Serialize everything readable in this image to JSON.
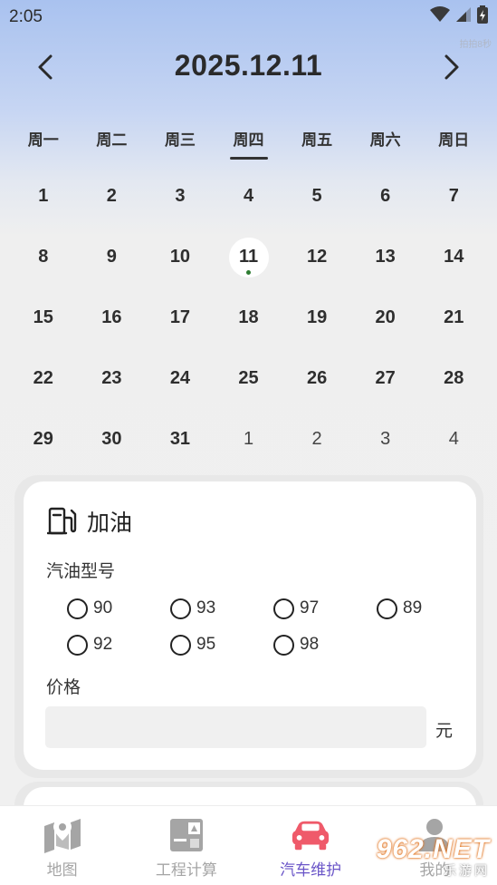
{
  "status": {
    "time": "2:05",
    "tiny": "拍拍8秒"
  },
  "header": {
    "title": "2025.12.11"
  },
  "weekdays": [
    "周一",
    "周二",
    "周三",
    "周四",
    "周五",
    "周六",
    "周日"
  ],
  "calendar": {
    "rows": [
      [
        "1",
        "2",
        "3",
        "4",
        "5",
        "6",
        "7"
      ],
      [
        "8",
        "9",
        "10",
        "11",
        "12",
        "13",
        "14"
      ],
      [
        "15",
        "16",
        "17",
        "18",
        "19",
        "20",
        "21"
      ],
      [
        "22",
        "23",
        "24",
        "25",
        "26",
        "27",
        "28"
      ],
      [
        "29",
        "30",
        "31",
        "1",
        "2",
        "3",
        "4"
      ]
    ]
  },
  "card": {
    "title": "加油",
    "fuel_type_label": "汽油型号",
    "options_row1": [
      "90",
      "93",
      "97",
      "89"
    ],
    "options_row2": [
      "92",
      "95",
      "98"
    ],
    "price_label": "价格",
    "price_value": "",
    "price_unit": "元"
  },
  "nav": {
    "tabs": [
      {
        "label": "地图"
      },
      {
        "label": "工程计算"
      },
      {
        "label": "汽车维护"
      },
      {
        "label": "我的"
      }
    ]
  },
  "watermark": {
    "main": "962.NET",
    "sub": "乐游网"
  },
  "colors": {
    "accent": "#6a55c8",
    "car_icon": "#ef5a6a",
    "today_dot": "#2e7d32",
    "inactive": "#a5a5a5"
  }
}
